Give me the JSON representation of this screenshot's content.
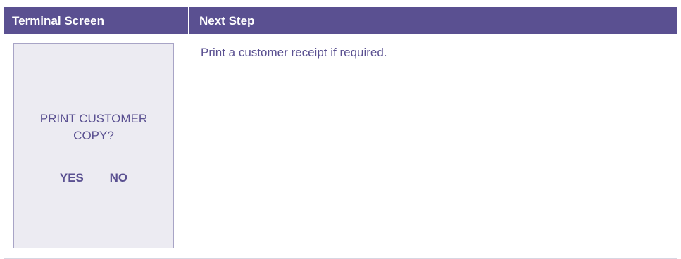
{
  "table": {
    "headers": {
      "terminal_screen": "Terminal Screen",
      "next_step": "Next Step"
    }
  },
  "terminal": {
    "prompt_line1": "PRINT CUSTOMER",
    "prompt_line2": "COPY?",
    "option_yes": "YES",
    "option_no": "NO"
  },
  "next_step": {
    "text": "Print a customer receipt if required."
  },
  "colors": {
    "accent": "#5a5091",
    "screen_background": "#ecebf2",
    "screen_border": "#a8a4c6"
  }
}
